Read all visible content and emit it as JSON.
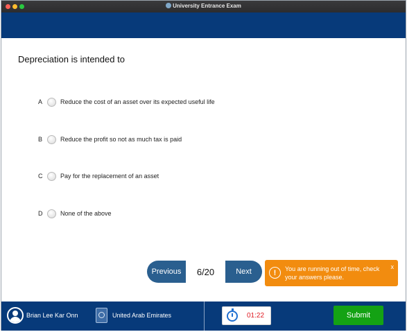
{
  "window": {
    "title": "University Entrance Exam"
  },
  "question": {
    "text": "Depreciation is intended to",
    "options": [
      {
        "letter": "A",
        "text": "Reduce the cost of an asset over its expected useful life"
      },
      {
        "letter": "B",
        "text": "Reduce the profit so not as much tax is paid"
      },
      {
        "letter": "C",
        "text": "Pay for the replacement of an asset"
      },
      {
        "letter": "D",
        "text": "None of the above"
      }
    ]
  },
  "navigation": {
    "previous_label": "Previous",
    "next_label": "Next",
    "counter": "6/20"
  },
  "toast": {
    "icon": "exclamation-icon",
    "message": "You are running out of time, check your answers please.",
    "close_label": "x"
  },
  "footer": {
    "user_name": "Brian Lee Kar Onn",
    "country": "United Arab Emirates",
    "timer": "01:22",
    "submit_label": "Submit"
  },
  "colors": {
    "header_blue": "#073a7a",
    "nav_button": "#2a5f8f",
    "warning_orange": "#f28c0f",
    "submit_green": "#14a214",
    "timer_red": "#e01b24"
  }
}
